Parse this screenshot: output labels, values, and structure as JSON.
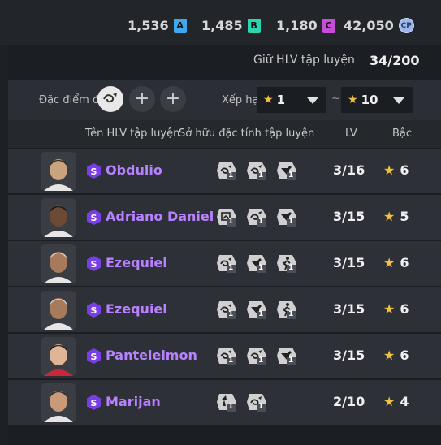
{
  "currencies": [
    {
      "value": "1,536",
      "icon": "A",
      "color": "#40a8ee"
    },
    {
      "value": "1,485",
      "icon": "B",
      "color": "#2dd4b0"
    },
    {
      "value": "1,180",
      "icon": "C",
      "color": "#c84bd9"
    },
    {
      "value": "42,050",
      "icon": "coin-icon",
      "color": "#9fb7e8"
    }
  ],
  "coach_count": {
    "label": "Giữ HLV tập luyện",
    "value": "34/200"
  },
  "filter": {
    "trait_label": "Đặc điểm đ",
    "rank_label": "Xếp hạ",
    "min_value": "1",
    "max_value": "10",
    "separator": "~"
  },
  "columns": {
    "name": "Tên HLV tập luyện",
    "traits": "Sở hữu đặc tính tập luyện",
    "level": "LV",
    "grade": "Bậc"
  },
  "rows": [
    {
      "name": "Obdulio",
      "level": "3/16",
      "grade": "6",
      "traits": [
        "1",
        "1",
        "1"
      ]
    },
    {
      "name": "Adriano Daniel",
      "level": "3/15",
      "grade": "5",
      "traits": [
        "1",
        "1",
        "1"
      ]
    },
    {
      "name": "Ezequiel",
      "level": "3/15",
      "grade": "6",
      "traits": [
        "1",
        "1",
        "1"
      ]
    },
    {
      "name": "Ezequiel",
      "level": "3/15",
      "grade": "6",
      "traits": [
        "1",
        "1",
        "1"
      ]
    },
    {
      "name": "Panteleimon",
      "level": "3/15",
      "grade": "6",
      "traits": [
        "1",
        "1",
        "1"
      ]
    },
    {
      "name": "Marijan",
      "level": "2/10",
      "grade": "4",
      "traits": [
        "1",
        "1"
      ]
    }
  ],
  "badge_letter": "S",
  "coin_letter": "CP"
}
